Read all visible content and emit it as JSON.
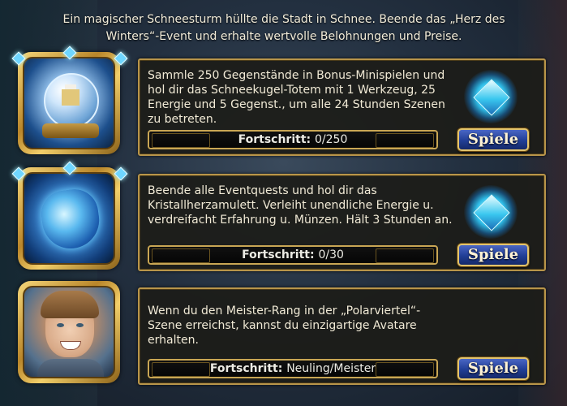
{
  "intro": "Ein magischer Schneesturm hüllte die Stadt in Schnee. Beende das „Herz des Winters“-Event und erhalte wertvolle Belohnungen und Preise.",
  "quests": [
    {
      "description": "Sammle 250 Gegenstände in Bonus-Minispielen und hol dir das Schneekugel-Totem mit 1 Werkzeug, 25 Energie und 5 Gegenst., um alle 24 Stunden Szenen zu betreten.",
      "progress_label": "Fortschritt:",
      "progress_value": "0/250",
      "button_label": "Spiele",
      "reward_icon": "snow-globe-icon",
      "has_gem": true
    },
    {
      "description": "Beende alle Eventquests und hol dir das Kristallherzamulett. Verleiht unendliche Energie u. verdreifacht Erfahrung u. Münzen. Hält 3 Stunden an.",
      "progress_label": "Fortschritt:",
      "progress_value": "0/30",
      "button_label": "Spiele",
      "reward_icon": "crystal-heart-icon",
      "has_gem": true
    },
    {
      "description": "Wenn du den Meister-Rang in der „Polarviertel“-Szene erreichst, kannst du einzigartige Avatare erhalten.",
      "progress_label": "Fortschritt:",
      "progress_value": "Neuling/Meister",
      "button_label": "Spiele",
      "reward_icon": "avatar-portrait-icon",
      "has_gem": false
    }
  ],
  "colors": {
    "panel_border": "#b8954a",
    "button": "#213e96",
    "gem": "#2fbde8",
    "text": "#f1ead6"
  }
}
